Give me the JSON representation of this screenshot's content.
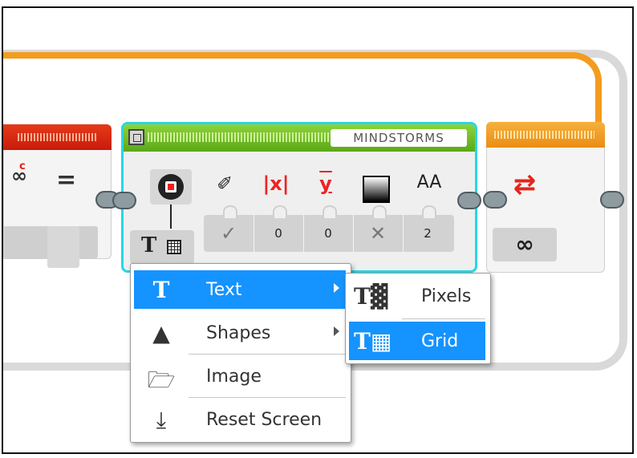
{
  "blocks": {
    "compare_symbol": "=",
    "link_mark": "c",
    "brand_label": "MINDSTORMS",
    "param_values": [
      "0",
      "0",
      "2"
    ],
    "font_glyph": "AA",
    "loop_count_symbol": "∞",
    "y_label": "y",
    "x_label": "x"
  },
  "context_menu": {
    "items": [
      {
        "label": "Text",
        "icon": "text-T-icon",
        "has_submenu": true,
        "selected": true
      },
      {
        "label": "Shapes",
        "icon": "shapes-icon",
        "has_submenu": true,
        "selected": false
      },
      {
        "label": "Image",
        "icon": "folder-icon",
        "has_submenu": false,
        "selected": false
      },
      {
        "label": "Reset Screen",
        "icon": "download-reset-icon",
        "has_submenu": false,
        "selected": false
      }
    ]
  },
  "submenu": {
    "items": [
      {
        "label": "Pixels",
        "icon": "text-pixels-icon",
        "selected": false
      },
      {
        "label": "Grid",
        "icon": "text-grid-icon",
        "selected": true
      }
    ]
  },
  "colors": {
    "selection": "#1593ff",
    "highlight_border": "#27d6e6",
    "display_header": "#6bbd22",
    "loop_header": "#f39c1d",
    "math_header": "#e03414"
  }
}
